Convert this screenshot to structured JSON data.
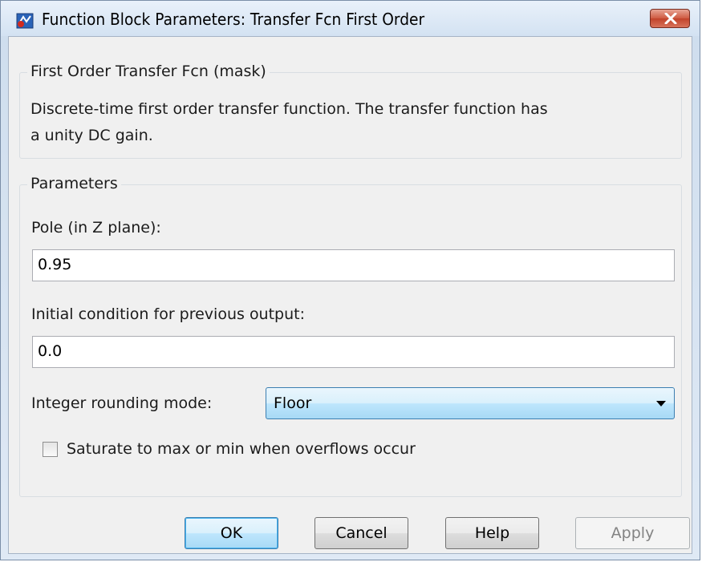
{
  "window": {
    "title": "Function Block Parameters: Transfer Fcn First Order",
    "icon": "simulink-block-icon",
    "close_icon": "close-x-icon"
  },
  "mask_group": {
    "label": "First Order Transfer Fcn (mask)",
    "description_line1": "Discrete-time first order transfer function.  The transfer function has",
    "description_line2": "a unity DC gain."
  },
  "parameters_group": {
    "label": "Parameters",
    "pole": {
      "label": "Pole (in Z plane):",
      "value": "0.95"
    },
    "initial_condition": {
      "label": "Initial condition for previous output:",
      "value": "0.0"
    },
    "rounding_mode": {
      "label": "Integer rounding mode:",
      "selected": "Floor"
    },
    "saturate": {
      "label": "Saturate to max or min when overflows occur",
      "checked": false
    }
  },
  "buttons": {
    "ok": "OK",
    "cancel": "Cancel",
    "help": "Help",
    "apply": "Apply"
  },
  "colors": {
    "close_button": "#c1432b",
    "default_button_border": "#3c7fb1"
  }
}
